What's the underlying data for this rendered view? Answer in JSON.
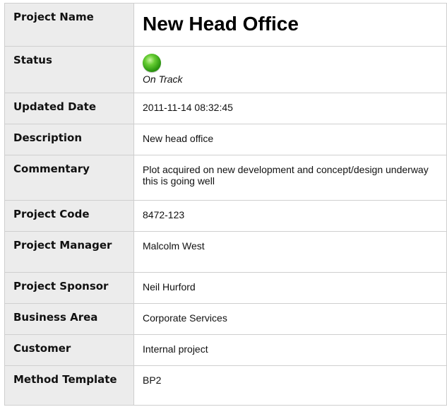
{
  "project": {
    "rows": {
      "name": {
        "label": "Project Name",
        "value": "New Head Office"
      },
      "status": {
        "label": "Status",
        "value": "On Track",
        "indicator": "green-status-icon",
        "color": "#3aa317"
      },
      "updated": {
        "label": "Updated Date",
        "value": "2011-11-14 08:32:45"
      },
      "description": {
        "label": "Description",
        "value": "New head office"
      },
      "commentary": {
        "label": "Commentary",
        "value": "Plot acquired on new development and concept/design underway this is going well"
      },
      "code": {
        "label": "Project Code",
        "value": "8472-123"
      },
      "manager": {
        "label": "Project Manager",
        "value": "Malcolm West"
      },
      "sponsor": {
        "label": "Project Sponsor",
        "value": "Neil Hurford"
      },
      "business_area": {
        "label": "Business Area",
        "value": "Corporate Services"
      },
      "customer": {
        "label": "Customer",
        "value": "Internal project"
      },
      "method_template": {
        "label": "Method Template",
        "value": "BP2"
      }
    }
  }
}
